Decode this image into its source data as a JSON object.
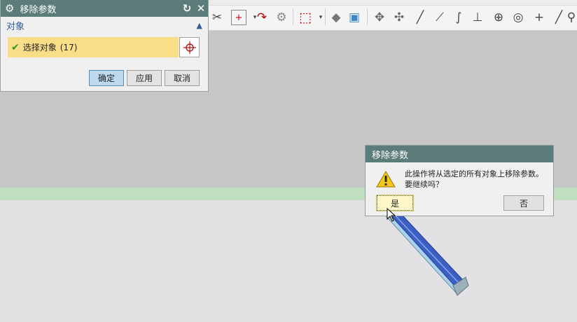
{
  "panel": {
    "title": "移除参数",
    "section_label": "对象",
    "select_label": "选择对象",
    "select_count": "(17)",
    "buttons": {
      "ok": "确定",
      "apply": "应用",
      "cancel": "取消"
    }
  },
  "dialog": {
    "title": "移除参数",
    "message": "此操作将从选定的所有对象上移除参数。要继续吗？",
    "yes_label": "是",
    "no_label": "否"
  },
  "icons": {
    "panel_settings": "gear-icon",
    "panel_reset": "reset-icon",
    "panel_close": "close-icon",
    "section_collapse": "chevron-up-icon",
    "select_status": "checkmark-icon",
    "select_target": "crosshair-icon",
    "dialog_warning": "warning-icon"
  },
  "colors": {
    "titlebar": "#5b7c79",
    "selection_highlight": "#fadd87",
    "default_button": "#bcd9ef",
    "section_header_text": "#2c5d93",
    "checkmark": "#2a9a2a",
    "viewport_band": "#bfdfc0"
  }
}
